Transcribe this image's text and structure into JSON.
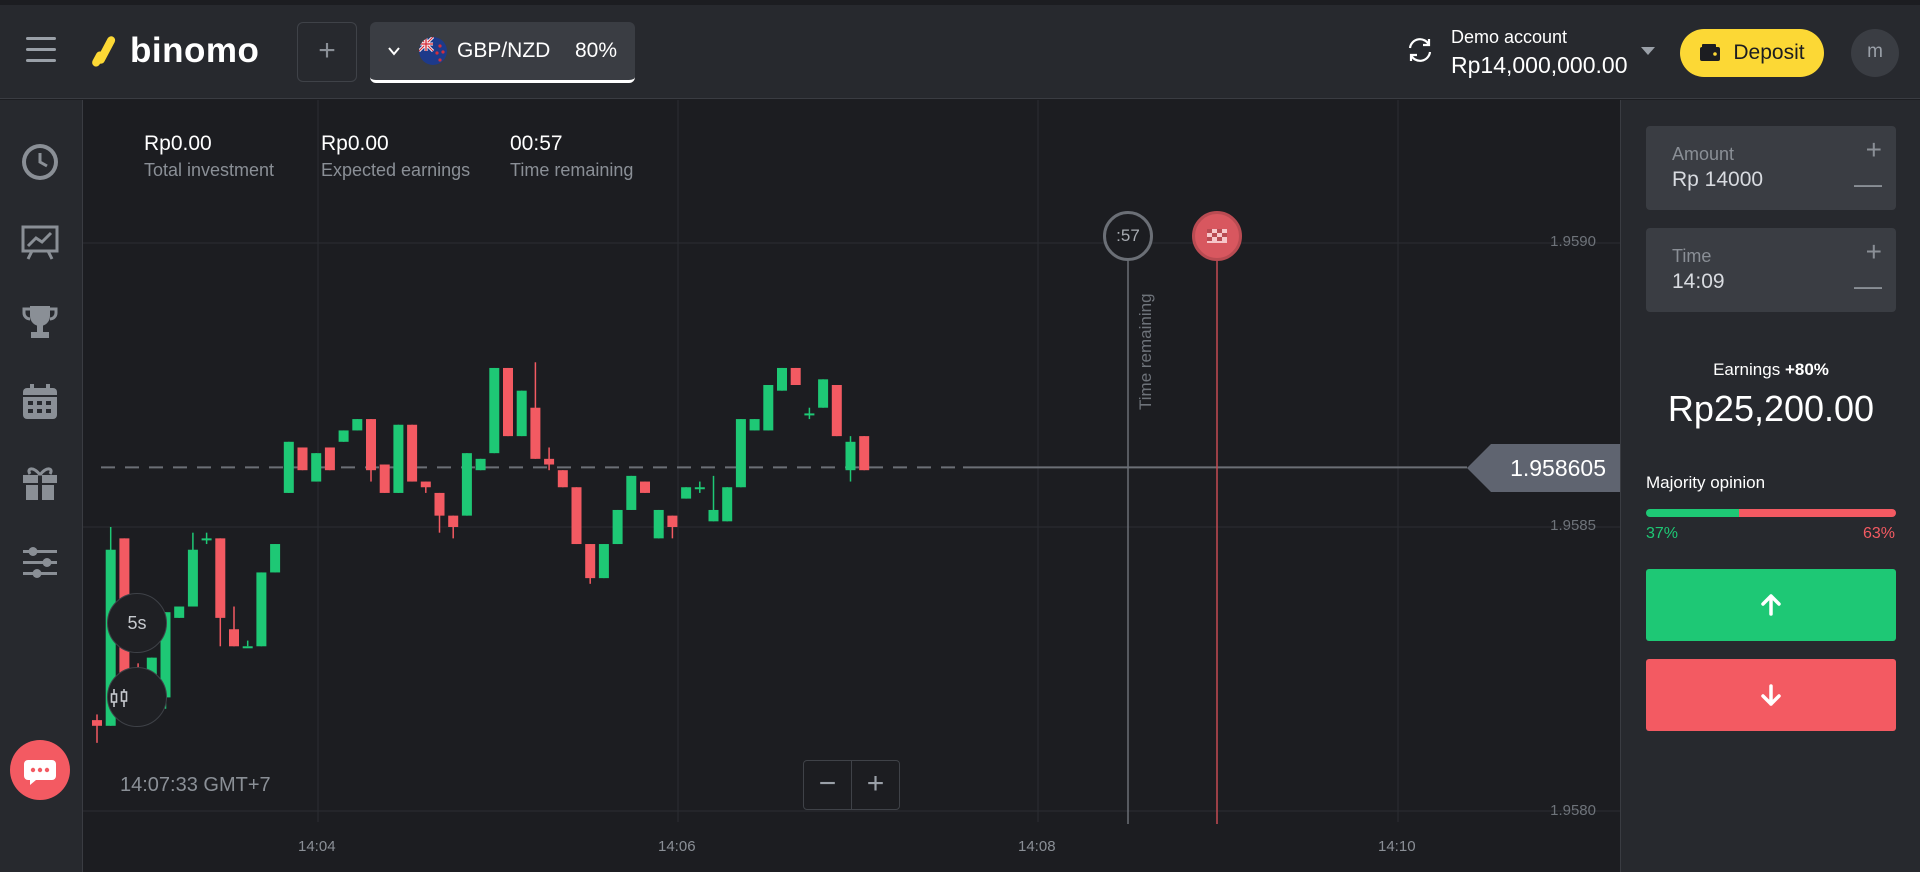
{
  "header": {
    "logo_text": "binomo",
    "asset": {
      "name": "GBP/NZD",
      "payout": "80%"
    },
    "account": {
      "label": "Demo account",
      "balance": "Rp14,000,000.00"
    },
    "deposit_label": "Deposit",
    "avatar_letter": "m"
  },
  "sidebar": {
    "items": [
      {
        "icon": "clock-icon"
      },
      {
        "icon": "chart-board-icon"
      },
      {
        "icon": "trophy-icon"
      },
      {
        "icon": "calendar-icon"
      },
      {
        "icon": "gift-icon"
      },
      {
        "icon": "sliders-icon"
      }
    ],
    "chat_icon": "chat-icon"
  },
  "chart": {
    "stats": [
      {
        "value": "Rp0.00",
        "label": "Total investment"
      },
      {
        "value": "Rp0.00",
        "label": "Expected earnings"
      },
      {
        "value": "00:57",
        "label": "Time remaining"
      }
    ],
    "current_price": "1.958605",
    "timer_short": ":57",
    "time_remaining_vertical": "Time remaining",
    "timeframe": "5s",
    "candle_type_icon": "candles-icon",
    "clock": "14:07:33 GMT+7",
    "zoom_out": "−",
    "zoom_in": "+",
    "y_ticks": [
      "1.9590",
      "1.9585",
      "1.9580"
    ],
    "x_ticks": [
      "14:04",
      "14:06",
      "14:08",
      "14:10"
    ],
    "colors": {
      "up": "#1ec875",
      "down": "#f35a62"
    }
  },
  "chart_data": {
    "type": "candlestick",
    "x_ticks": [
      "14:04",
      "14:06",
      "14:08",
      "14:10"
    ],
    "y_ticks": [
      1.958,
      1.9585,
      1.959
    ],
    "ylim": [
      1.958,
      1.9591
    ],
    "current_price": 1.958605,
    "series": [
      {
        "o": 1.95816,
        "c": 1.95815,
        "h": 1.95817,
        "l": 1.95812
      },
      {
        "o": 1.95815,
        "c": 1.95846,
        "h": 1.9585,
        "l": 1.95815
      },
      {
        "o": 1.95848,
        "c": 1.95823,
        "h": 1.95848,
        "l": 1.95823
      },
      {
        "o": 1.95823,
        "c": 1.9582,
        "h": 1.95826,
        "l": 1.95816
      },
      {
        "o": 1.9582,
        "c": 1.95827,
        "h": 1.95827,
        "l": 1.95819
      },
      {
        "o": 1.9582,
        "c": 1.95835,
        "h": 1.95835,
        "l": 1.95818
      },
      {
        "o": 1.95834,
        "c": 1.95836,
        "h": 1.95836,
        "l": 1.95834
      },
      {
        "o": 1.95836,
        "c": 1.95846,
        "h": 1.95849,
        "l": 1.95836
      },
      {
        "o": 1.95848,
        "c": 1.95848,
        "h": 1.95849,
        "l": 1.95847
      },
      {
        "o": 1.95848,
        "c": 1.95834,
        "h": 1.95848,
        "l": 1.95829
      },
      {
        "o": 1.95832,
        "c": 1.95829,
        "h": 1.95836,
        "l": 1.95829
      },
      {
        "o": 1.95829,
        "c": 1.95829,
        "h": 1.9583,
        "l": 1.95829
      },
      {
        "o": 1.95829,
        "c": 1.95842,
        "h": 1.95842,
        "l": 1.95829
      },
      {
        "o": 1.95842,
        "c": 1.95847,
        "h": 1.95847,
        "l": 1.95842
      },
      {
        "o": 1.95856,
        "c": 1.95865,
        "h": 1.95865,
        "l": 1.95856
      },
      {
        "o": 1.95864,
        "c": 1.9586,
        "h": 1.95864,
        "l": 1.9586
      },
      {
        "o": 1.95858,
        "c": 1.95863,
        "h": 1.95863,
        "l": 1.95858
      },
      {
        "o": 1.95864,
        "c": 1.9586,
        "h": 1.95864,
        "l": 1.9586
      },
      {
        "o": 1.95865,
        "c": 1.95867,
        "h": 1.95867,
        "l": 1.95865
      },
      {
        "o": 1.95867,
        "c": 1.95869,
        "h": 1.95869,
        "l": 1.95867
      },
      {
        "o": 1.95869,
        "c": 1.9586,
        "h": 1.95869,
        "l": 1.95858
      },
      {
        "o": 1.95861,
        "c": 1.95856,
        "h": 1.95861,
        "l": 1.95856
      },
      {
        "o": 1.95856,
        "c": 1.95868,
        "h": 1.95868,
        "l": 1.95856
      },
      {
        "o": 1.95868,
        "c": 1.95858,
        "h": 1.95868,
        "l": 1.95858
      },
      {
        "o": 1.95858,
        "c": 1.95857,
        "h": 1.95858,
        "l": 1.95856
      },
      {
        "o": 1.95856,
        "c": 1.95852,
        "h": 1.95856,
        "l": 1.95849
      },
      {
        "o": 1.95852,
        "c": 1.9585,
        "h": 1.95852,
        "l": 1.95848
      },
      {
        "o": 1.95852,
        "c": 1.95863,
        "h": 1.95863,
        "l": 1.95852
      },
      {
        "o": 1.9586,
        "c": 1.95862,
        "h": 1.95862,
        "l": 1.9586
      },
      {
        "o": 1.95863,
        "c": 1.95878,
        "h": 1.95878,
        "l": 1.95863
      },
      {
        "o": 1.95878,
        "c": 1.95866,
        "h": 1.95878,
        "l": 1.95866
      },
      {
        "o": 1.95866,
        "c": 1.95874,
        "h": 1.95874,
        "l": 1.95866
      },
      {
        "o": 1.95871,
        "c": 1.95862,
        "h": 1.95879,
        "l": 1.95862
      },
      {
        "o": 1.95862,
        "c": 1.95861,
        "h": 1.95864,
        "l": 1.9586
      },
      {
        "o": 1.9586,
        "c": 1.95857,
        "h": 1.9586,
        "l": 1.95857
      },
      {
        "o": 1.95857,
        "c": 1.95847,
        "h": 1.95857,
        "l": 1.95847
      },
      {
        "o": 1.95847,
        "c": 1.95841,
        "h": 1.95847,
        "l": 1.9584
      },
      {
        "o": 1.95841,
        "c": 1.95847,
        "h": 1.95847,
        "l": 1.95841
      },
      {
        "o": 1.95847,
        "c": 1.95853,
        "h": 1.95853,
        "l": 1.95847
      },
      {
        "o": 1.95853,
        "c": 1.95859,
        "h": 1.95859,
        "l": 1.95853
      },
      {
        "o": 1.95858,
        "c": 1.95856,
        "h": 1.95858,
        "l": 1.95856
      },
      {
        "o": 1.95848,
        "c": 1.95853,
        "h": 1.95853,
        "l": 1.95848
      },
      {
        "o": 1.95852,
        "c": 1.9585,
        "h": 1.95852,
        "l": 1.95848
      },
      {
        "o": 1.95855,
        "c": 1.95857,
        "h": 1.95857,
        "l": 1.95855
      },
      {
        "o": 1.95857,
        "c": 1.95857,
        "h": 1.95858,
        "l": 1.95856
      },
      {
        "o": 1.95851,
        "c": 1.95853,
        "h": 1.95859,
        "l": 1.95851
      },
      {
        "o": 1.95851,
        "c": 1.95857,
        "h": 1.95857,
        "l": 1.95851
      },
      {
        "o": 1.95857,
        "c": 1.95869,
        "h": 1.95869,
        "l": 1.95857
      },
      {
        "o": 1.95867,
        "c": 1.95869,
        "h": 1.95869,
        "l": 1.95867
      },
      {
        "o": 1.95867,
        "c": 1.95875,
        "h": 1.95875,
        "l": 1.95867
      },
      {
        "o": 1.95874,
        "c": 1.95878,
        "h": 1.95878,
        "l": 1.95874
      },
      {
        "o": 1.95878,
        "c": 1.95875,
        "h": 1.95878,
        "l": 1.95875
      },
      {
        "o": 1.9587,
        "c": 1.9587,
        "h": 1.95871,
        "l": 1.95869
      },
      {
        "o": 1.95871,
        "c": 1.95876,
        "h": 1.95876,
        "l": 1.95871
      },
      {
        "o": 1.95875,
        "c": 1.95866,
        "h": 1.95875,
        "l": 1.95866
      },
      {
        "o": 1.9586,
        "c": 1.95865,
        "h": 1.95866,
        "l": 1.95858
      },
      {
        "o": 1.95866,
        "c": 1.9586,
        "h": 1.95866,
        "l": 1.9586
      }
    ]
  },
  "panel": {
    "amount": {
      "label": "Amount",
      "value": "Rp 14000"
    },
    "time": {
      "label": "Time",
      "value": "14:09"
    },
    "plus": "+",
    "minus": "—",
    "earnings_label": "Earnings",
    "earnings_pct": "+80%",
    "earnings_value": "Rp25,200.00",
    "majority_label": "Majority opinion",
    "majority_up": "37%",
    "majority_down": "63%",
    "majority_up_fraction": 0.37,
    "up_icon": "arrow-up-icon",
    "down_icon": "arrow-down-icon"
  }
}
